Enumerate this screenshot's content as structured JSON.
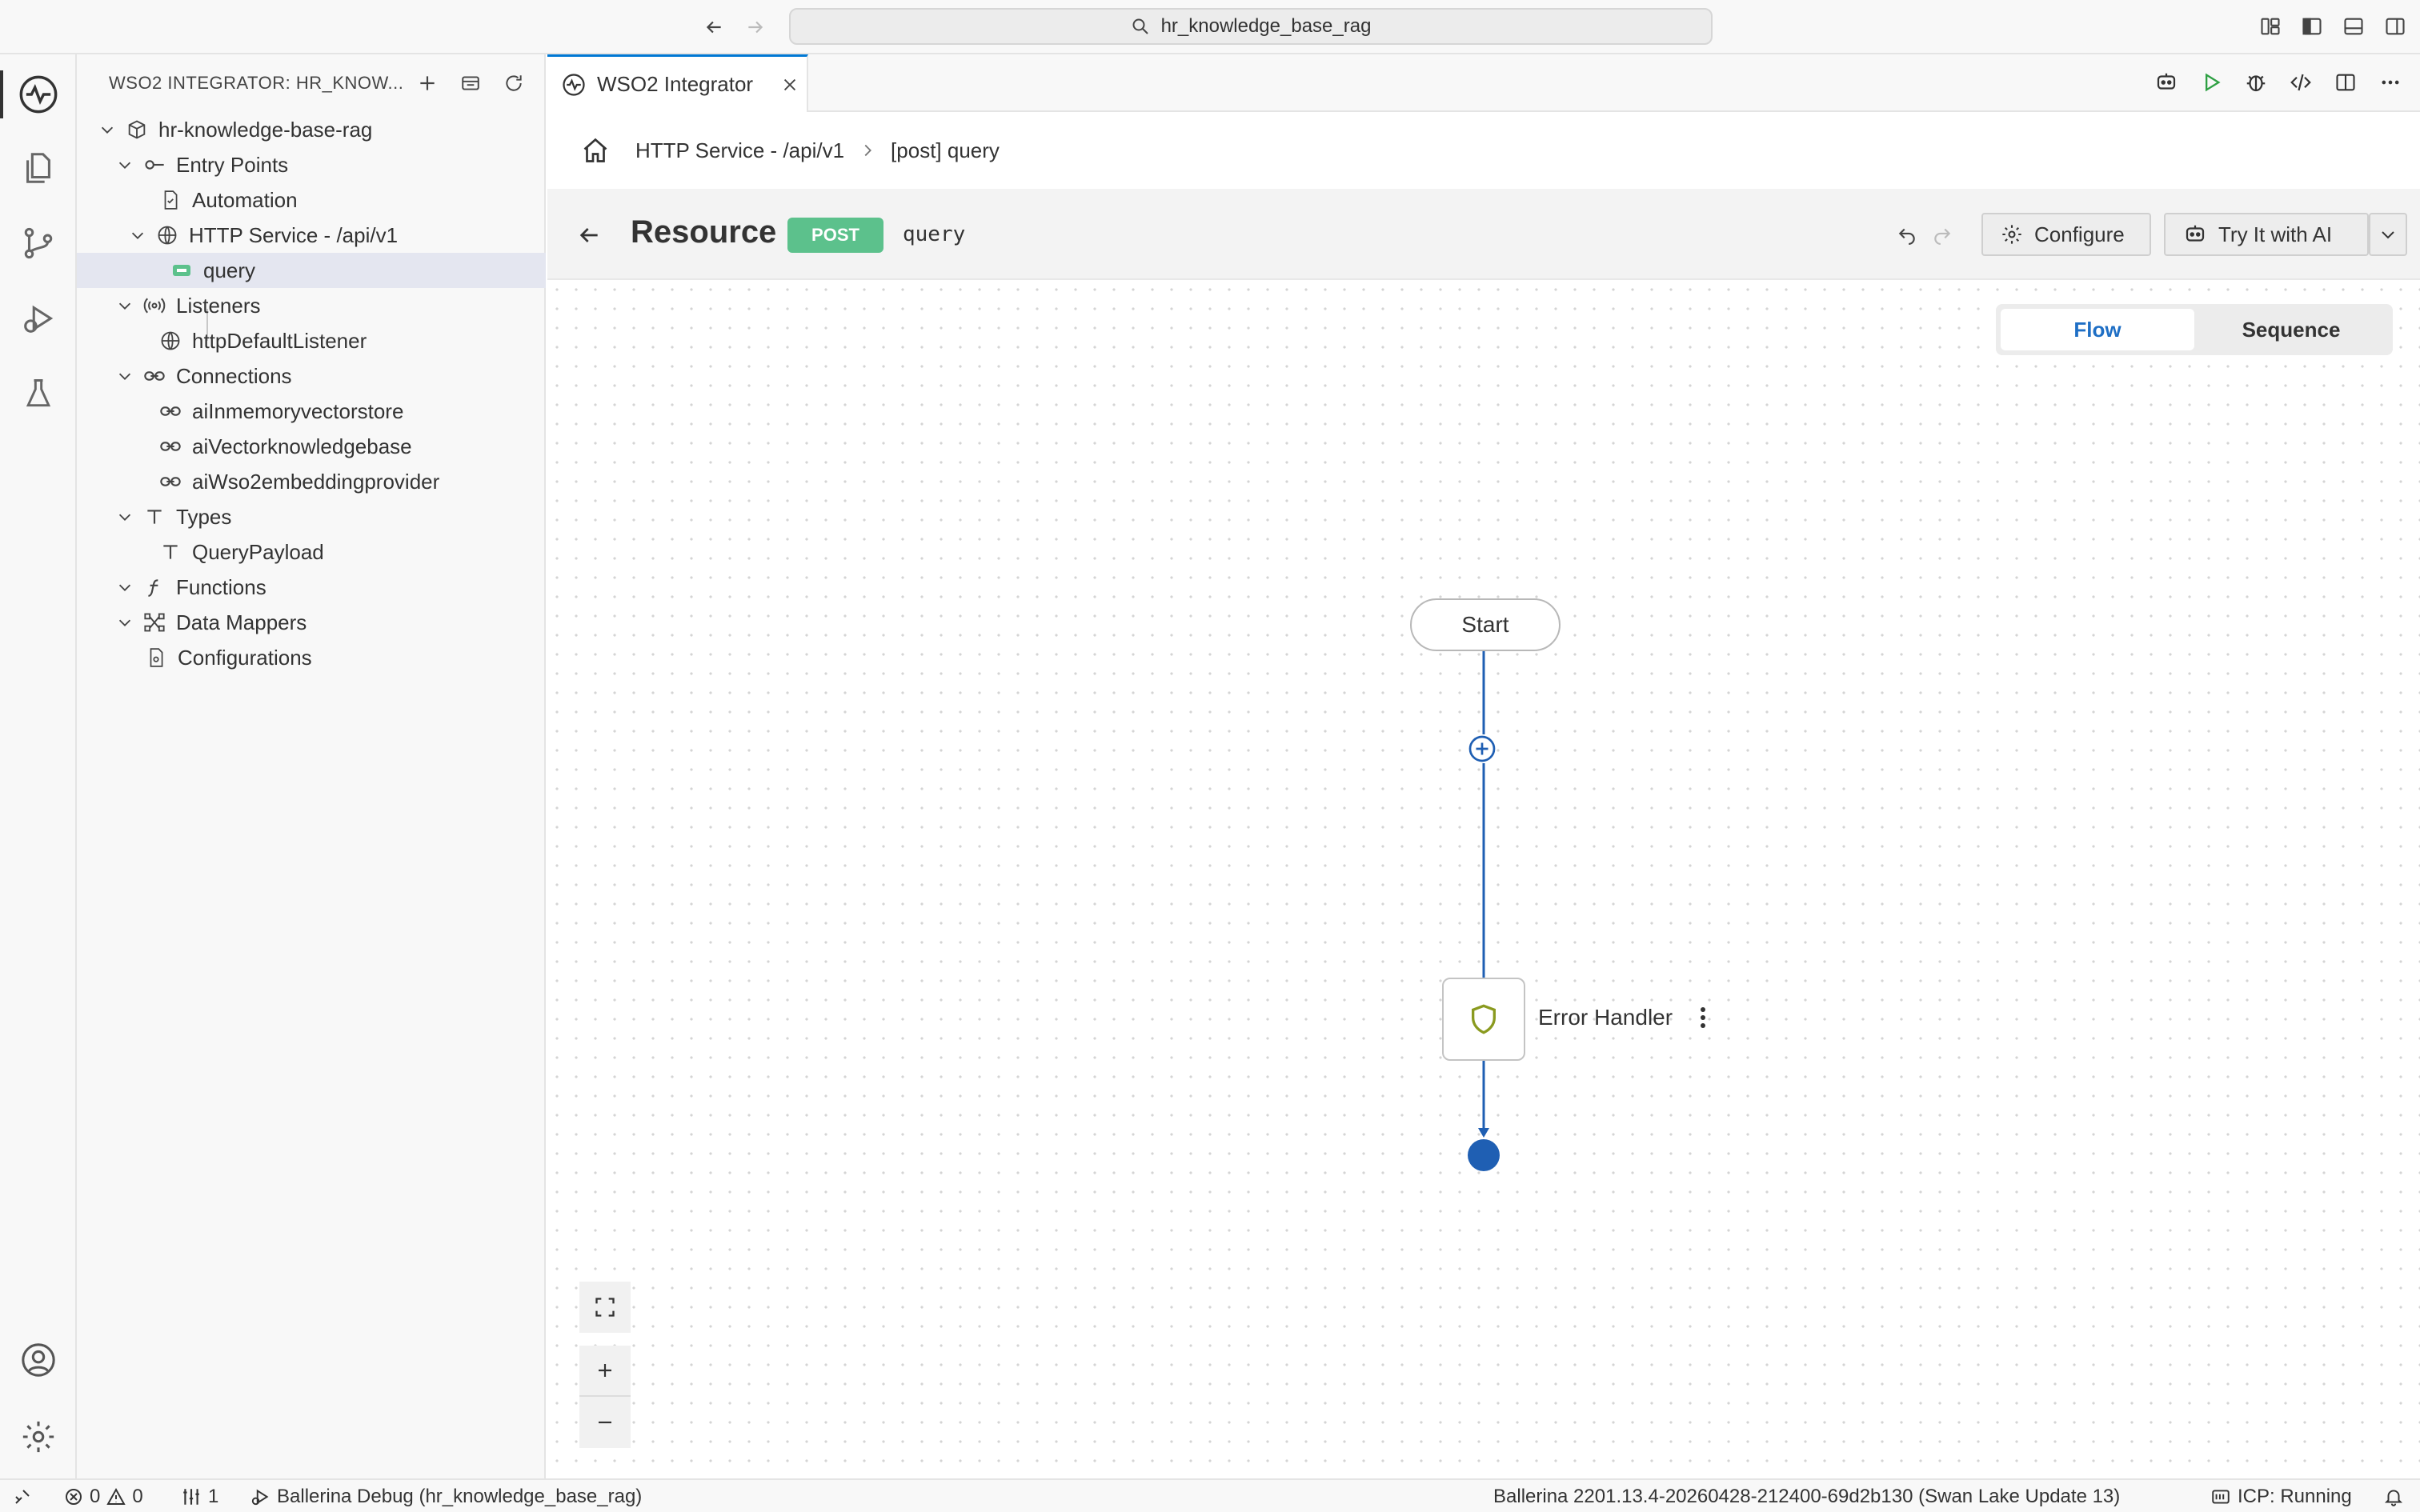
{
  "window": {
    "search_text": "hr_knowledge_base_rag"
  },
  "sidebar": {
    "title": "WSO2 INTEGRATOR: HR_KNOW...",
    "tree": [
      {
        "label": "hr-knowledge-base-rag",
        "icon": "package-icon",
        "level": 0,
        "expanded": true
      },
      {
        "label": "Entry Points",
        "icon": "entry-points-icon",
        "level": 1,
        "expanded": true
      },
      {
        "label": "Automation",
        "icon": "automation-file-icon",
        "level": 2
      },
      {
        "label": "HTTP Service - /api/v1",
        "icon": "globe-icon",
        "level": 2,
        "expanded": true
      },
      {
        "label": "query",
        "icon": "post-resource-icon",
        "level": 3,
        "selected": true
      },
      {
        "label": "Listeners",
        "icon": "listener-broadcast-icon",
        "level": 1,
        "expanded": true
      },
      {
        "label": "httpDefaultListener",
        "icon": "globe-icon",
        "level": 2
      },
      {
        "label": "Connections",
        "icon": "link-icon",
        "level": 1,
        "expanded": true
      },
      {
        "label": "aiInmemoryvectorstore",
        "icon": "link-icon",
        "level": 2
      },
      {
        "label": "aiVectorknowledgebase",
        "icon": "link-icon",
        "level": 2
      },
      {
        "label": "aiWso2embeddingprovider",
        "icon": "link-icon",
        "level": 2
      },
      {
        "label": "Types",
        "icon": "type-icon",
        "level": 1,
        "expanded": true
      },
      {
        "label": "QueryPayload",
        "icon": "type-icon",
        "level": 2
      },
      {
        "label": "Functions",
        "icon": "function-icon",
        "level": 1,
        "expanded": true
      },
      {
        "label": "Data Mappers",
        "icon": "data-mapper-icon",
        "level": 1,
        "expanded": true
      },
      {
        "label": "Configurations",
        "icon": "config-file-icon",
        "level": 1
      }
    ]
  },
  "tab": {
    "label": "WSO2 Integrator"
  },
  "breadcrumb": {
    "service": "HTTP Service - /api/v1",
    "resource": "[post] query"
  },
  "resource": {
    "title": "Resource",
    "method": "POST",
    "path": "query",
    "configure_label": "Configure",
    "try_label": "Try It with AI"
  },
  "view_toggle": {
    "flow": "Flow",
    "sequence": "Sequence",
    "active": "Flow"
  },
  "diagram": {
    "start_label": "Start",
    "error_handler_label": "Error Handler"
  },
  "statusbar": {
    "errors": "0",
    "warnings": "0",
    "ports": "1",
    "debug": "Ballerina Debug (hr_knowledge_base_rag)",
    "version": "Ballerina 2201.13.4-20260428-212400-69d2b130 (Swan Lake Update 13)",
    "icp": "ICP: Running"
  },
  "colors": {
    "accent": "#1f6fc5",
    "post_badge": "#5cc18c",
    "flow_line": "#1f5fb3",
    "shield": "#8a9a1f"
  }
}
